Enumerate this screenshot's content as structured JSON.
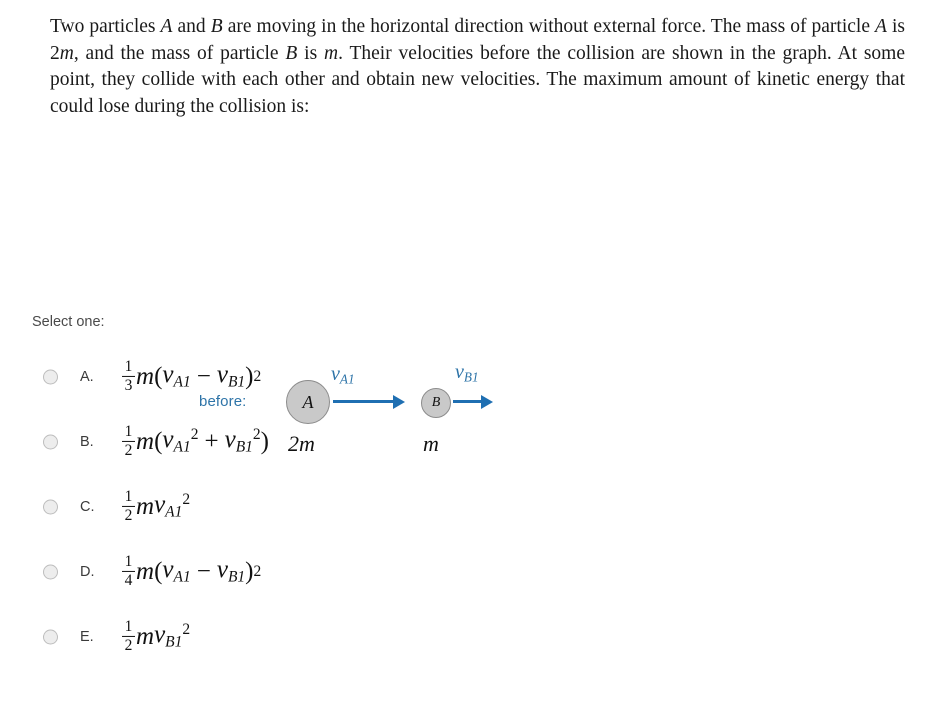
{
  "question": {
    "text_parts": [
      {
        "t": "Two particles ",
        "i": false
      },
      {
        "t": "A",
        "i": true
      },
      {
        "t": " and ",
        "i": false
      },
      {
        "t": "B",
        "i": true
      },
      {
        "t": " are moving in the horizontal direction without external force. The mass of particle ",
        "i": false
      },
      {
        "t": "A",
        "i": true
      },
      {
        "t": " is 2",
        "i": false
      },
      {
        "t": "m",
        "i": true
      },
      {
        "t": ", and the mass of particle ",
        "i": false
      },
      {
        "t": "B",
        "i": true
      },
      {
        "t": " is ",
        "i": false
      },
      {
        "t": "m",
        "i": true
      },
      {
        "t": ". Their velocities before the collision are shown in the graph. At some point, they collide with each other and obtain new velocities. The maximum amount of kinetic energy that could lose during the collision is:",
        "i": false
      }
    ]
  },
  "diagram": {
    "before_label": "before:",
    "particle_a_label": "A",
    "particle_b_label": "B",
    "velocity_a_var": "v",
    "velocity_a_sub": "A1",
    "velocity_b_var": "v",
    "velocity_b_sub": "B1",
    "mass_a_label": "2m",
    "mass_b_label": "m",
    "arrow_color": "#1f6fb2",
    "label_color": "#2e74a8",
    "particle_fill": "#c9c9c9",
    "particle_stroke": "#8c8c8c"
  },
  "answers": {
    "prompt": "Select one:",
    "options": [
      {
        "letter": "A.",
        "formula_text": "1/3 m(v_A1 - v_B1)^2",
        "num": "1",
        "den": "3",
        "m": "m",
        "open": "(",
        "v1": "v",
        "v1sub": "A1",
        "op": "−",
        "v2": "v",
        "v2sub": "B1",
        "close": ")",
        "sup": "2",
        "layout": "paren-power",
        "selected": false
      },
      {
        "letter": "B.",
        "formula_text": "1/2 m(v_A1^2 + v_B1^2)",
        "num": "1",
        "den": "2",
        "m": "m",
        "open": "(",
        "v1": "v",
        "v1sub": "A1",
        "v1sup": "2",
        "op": "+",
        "v2": "v",
        "v2sub": "B1",
        "v2sup": "2",
        "close": ")",
        "layout": "inner-powers",
        "selected": false
      },
      {
        "letter": "C.",
        "formula_text": "1/2 m v_A1^2",
        "num": "1",
        "den": "2",
        "m": "m",
        "v1": "v",
        "v1sub": "A1",
        "v1sup": "2",
        "layout": "single",
        "selected": false
      },
      {
        "letter": "D.",
        "formula_text": "1/4 m(v_A1 - v_B1)^2",
        "num": "1",
        "den": "4",
        "m": "m",
        "open": "(",
        "v1": "v",
        "v1sub": "A1",
        "op": "−",
        "v2": "v",
        "v2sub": "B1",
        "close": ")",
        "sup": "2",
        "layout": "paren-power",
        "selected": false
      },
      {
        "letter": "E.",
        "formula_text": "1/2 m v_B1^2",
        "num": "1",
        "den": "2",
        "m": "m",
        "v1": "v",
        "v1sub": "B1",
        "v1sup": "2",
        "layout": "single",
        "selected": false
      }
    ]
  }
}
